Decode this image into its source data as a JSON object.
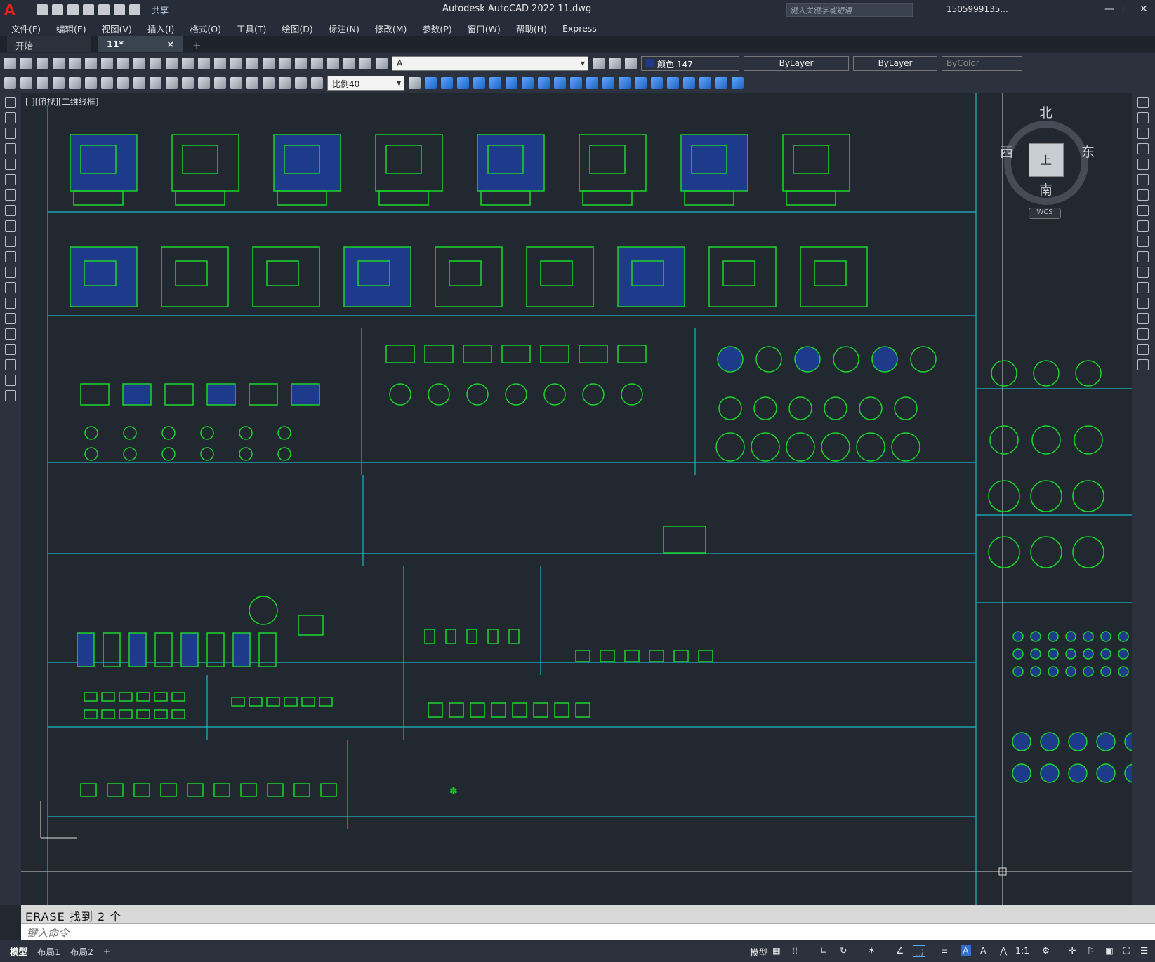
{
  "titlebar": {
    "title": "Autodesk AutoCAD 2022    11.dwg",
    "share": "共享",
    "search_placeholder": "键入关键字或短语",
    "user": "1505999135..."
  },
  "menu": [
    "文件(F)",
    "编辑(E)",
    "视图(V)",
    "插入(I)",
    "格式(O)",
    "工具(T)",
    "绘图(D)",
    "标注(N)",
    "修改(M)",
    "参数(P)",
    "窗口(W)",
    "帮助(H)",
    "Express"
  ],
  "tabs": {
    "start": "开始",
    "file": "11*",
    "close": "×",
    "new": "+"
  },
  "toolbar": {
    "layer": "A",
    "color": "颜色 147",
    "linetype": "ByLayer",
    "lineweight": "ByLayer",
    "plotstyle": "ByColor",
    "scale": "比例40"
  },
  "viewport": {
    "label": "[-][俯视][二维线框]"
  },
  "viewcube": {
    "north": "北",
    "south": "南",
    "east": "东",
    "west": "西",
    "top": "上",
    "wcs": "WCS"
  },
  "command": {
    "history": "ERASE  找到 2 个",
    "placeholder": "键入命令"
  },
  "layouts": [
    "模型",
    "布局1",
    "布局2",
    "+"
  ],
  "status": {
    "model": "模型",
    "scale": "1:1"
  },
  "colors": {
    "accent": "#1fb5c9",
    "blocks": "#1bd42a",
    "fill": "#1e3a8a"
  }
}
